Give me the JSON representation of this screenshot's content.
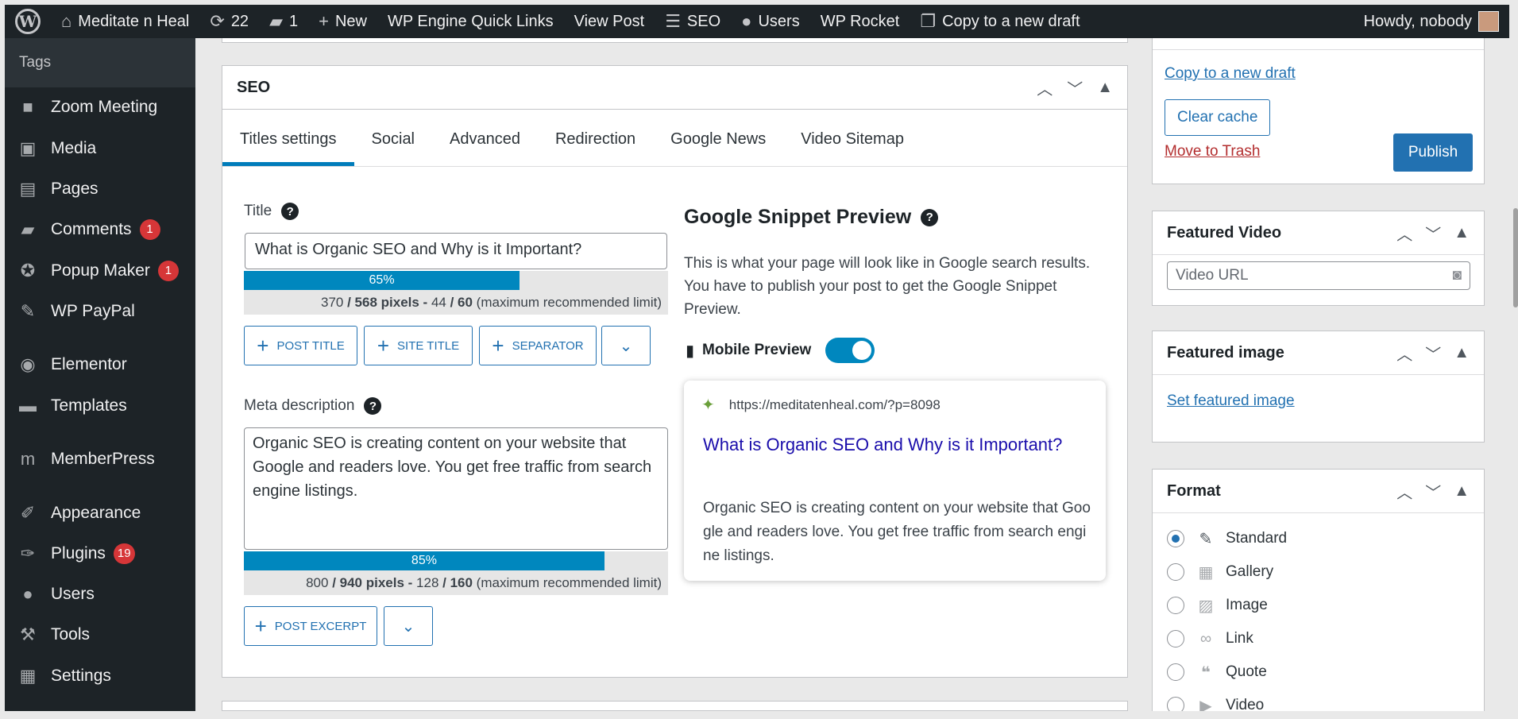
{
  "adminbar": {
    "site": "Meditate n Heal",
    "updates": "22",
    "comments": "1",
    "new_label": "New",
    "wpengine": "WP Engine Quick Links",
    "view_post": "View Post",
    "seo": "SEO",
    "users": "Users",
    "wprocket": "WP Rocket",
    "copy_draft": "Copy to a new draft",
    "howdy": "Howdy, nobody"
  },
  "sidebar": {
    "section": "Tags",
    "items": [
      {
        "label": "Zoom Meeting",
        "icon": "video-icon"
      },
      {
        "label": "Media",
        "icon": "media-icon"
      },
      {
        "label": "Pages",
        "icon": "pages-icon"
      },
      {
        "label": "Comments",
        "icon": "comment-icon",
        "badge": "1"
      },
      {
        "label": "Popup Maker",
        "icon": "popup-icon",
        "badge": "1"
      },
      {
        "label": "WP PayPal",
        "icon": "pin-icon"
      },
      {
        "label": "Elementor",
        "icon": "elementor-icon"
      },
      {
        "label": "Templates",
        "icon": "folder-icon"
      },
      {
        "label": "MemberPress",
        "icon": "memberpress-icon"
      },
      {
        "label": "Appearance",
        "icon": "brush-icon"
      },
      {
        "label": "Plugins",
        "icon": "plugin-icon",
        "badge": "19"
      },
      {
        "label": "Users",
        "icon": "user-icon"
      },
      {
        "label": "Tools",
        "icon": "wrench-icon"
      },
      {
        "label": "Settings",
        "icon": "settings-icon"
      }
    ]
  },
  "seo": {
    "box_title": "SEO",
    "tabs": [
      "Titles settings",
      "Social",
      "Advanced",
      "Redirection",
      "Google News",
      "Video Sitemap"
    ],
    "title_label": "Title",
    "title_value": "What is Organic SEO and Why is it Important?",
    "title_meter": {
      "percent": "65%",
      "fraction": 0.65,
      "text_a": "370",
      "text_b": " / 568 pixels - ",
      "text_c": "44",
      "text_d": " / 60",
      "text_e": " (maximum recommended limit)"
    },
    "btn_post_title": "POST TITLE",
    "btn_site_title": "SITE TITLE",
    "btn_separator": "SEPARATOR",
    "meta_label": "Meta description",
    "meta_value": "Organic SEO is creating content on your website that Google and readers love. You get free traffic from search engine listings.",
    "meta_meter": {
      "percent": "85%",
      "fraction": 0.85,
      "text_a": "800",
      "text_b": " / 940 pixels - ",
      "text_c": "128",
      "text_d": " / 160",
      "text_e": " (maximum recommended limit)"
    },
    "btn_post_excerpt": "POST EXCERPT",
    "snippet_title": "Google Snippet Preview",
    "snippet_desc": "This is what your page will look like in Google search results. You have to publish your post to get the Google Snippet Preview.",
    "mobile_preview": "Mobile Preview",
    "preview": {
      "url": "https://meditatenheal.com/?p=8098",
      "title": "What is Organic SEO and Why is it Important?",
      "desc": "Organic SEO is creating content on your website that Google and readers love. You get free traffic from search engine listings."
    }
  },
  "publish": {
    "copy_draft": "Copy to a new draft",
    "clear_cache": "Clear cache",
    "trash": "Move to Trash",
    "publish": "Publish"
  },
  "featured_video": {
    "title": "Featured Video",
    "placeholder": "Video URL"
  },
  "featured_image": {
    "title": "Featured image",
    "link": "Set featured image"
  },
  "format": {
    "title": "Format",
    "options": [
      "Standard",
      "Gallery",
      "Image",
      "Link",
      "Quote",
      "Video"
    ]
  },
  "colors": {
    "accent": "#2271b1",
    "meter": "#0087be",
    "badge": "#d63638",
    "adminbar": "#1d2327"
  }
}
